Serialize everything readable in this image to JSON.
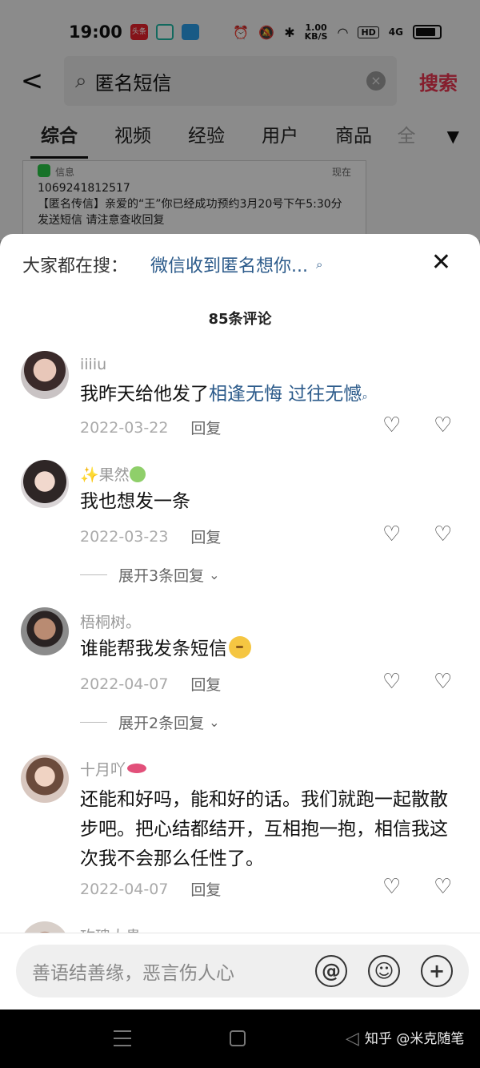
{
  "status_bar": {
    "time": "19:00",
    "badge_toutiao": "头条",
    "speed_value": "1.00",
    "speed_unit": "KB/S",
    "hd": "HD",
    "network": "4G"
  },
  "search": {
    "back_label": "<",
    "query": "匿名短信",
    "search_button": "搜索"
  },
  "tabs": [
    "综合",
    "视频",
    "经验",
    "用户",
    "商品",
    "全"
  ],
  "notice_card": {
    "app": "信息",
    "time": "现在",
    "sender": "1069241812517",
    "body": "【匿名传信】亲爱的“王”你已经成功预约3月20号下午5:30分发送短信 请注意查收回复"
  },
  "sheet": {
    "hot_label": "大家都在搜：",
    "hot_query": "微信收到匿名想你...",
    "comment_count": "85条评论"
  },
  "comments": [
    {
      "name": "iiiiu",
      "text_prefix": "我昨天给他发了",
      "link": "相逢无悔 过往无憾",
      "date": "2022-03-22",
      "reply": "回复"
    },
    {
      "name_prefix": "✨果然",
      "text": "我也想发一条",
      "date": "2022-03-23",
      "reply": "回复",
      "expand": "展开3条回复"
    },
    {
      "name": "梧桐树。",
      "text": "谁能帮我发条短信",
      "date": "2022-04-07",
      "reply": "回复",
      "expand": "展开2条回复"
    },
    {
      "name": "十月吖",
      "text": "还能和好吗，能和好的话。我们就跑一起散散步吧。把心结都结开，互相抱一抱，相信我这次我不会那么任性了。",
      "date": "2022-04-07",
      "reply": "回复"
    },
    {
      "name": "玫瑰大贵"
    }
  ],
  "input": {
    "placeholder": "善语结善缘，恶言伤人心"
  },
  "watermark": "知乎 @米克随笔"
}
